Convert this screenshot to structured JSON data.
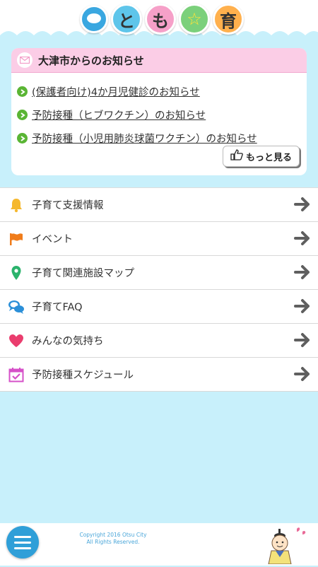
{
  "header": {
    "logo_chars": [
      "と",
      "も",
      "☆",
      "育"
    ]
  },
  "news": {
    "title": "大津市からのお知らせ",
    "items": [
      "(保護者向け)4か月児健診のお知らせ",
      "予防接種（ヒブワクチン）のお知らせ",
      "予防接種（小児用肺炎球菌ワクチン）のお知らせ"
    ],
    "more_label": "もっと見る"
  },
  "menu": [
    {
      "label": "子育て支援情報",
      "icon": "bell-icon",
      "color": "#f5b82e"
    },
    {
      "label": "イベント",
      "icon": "flag-icon",
      "color": "#f07c1a"
    },
    {
      "label": "子育て関連施設マップ",
      "icon": "map-pin-icon",
      "color": "#2bb36c"
    },
    {
      "label": "子育てFAQ",
      "icon": "chat-bubbles-icon",
      "color": "#2b8fd8"
    },
    {
      "label": "みんなの気持ち",
      "icon": "heart-icon",
      "color": "#ea3d6e"
    },
    {
      "label": "予防接種スケジュール",
      "icon": "calendar-check-icon",
      "color": "#d651c8"
    }
  ],
  "footer": {
    "copyright_line1": "Copyright 2016 Otsu City",
    "copyright_line2": "All Rights Reserved."
  },
  "colors": {
    "background": "#c8f0fb",
    "news_header": "#fbcde6",
    "accent_blue": "#2f9fd8",
    "bullet_green": "#5ab534",
    "arrow_gray": "#5f5f5f"
  }
}
